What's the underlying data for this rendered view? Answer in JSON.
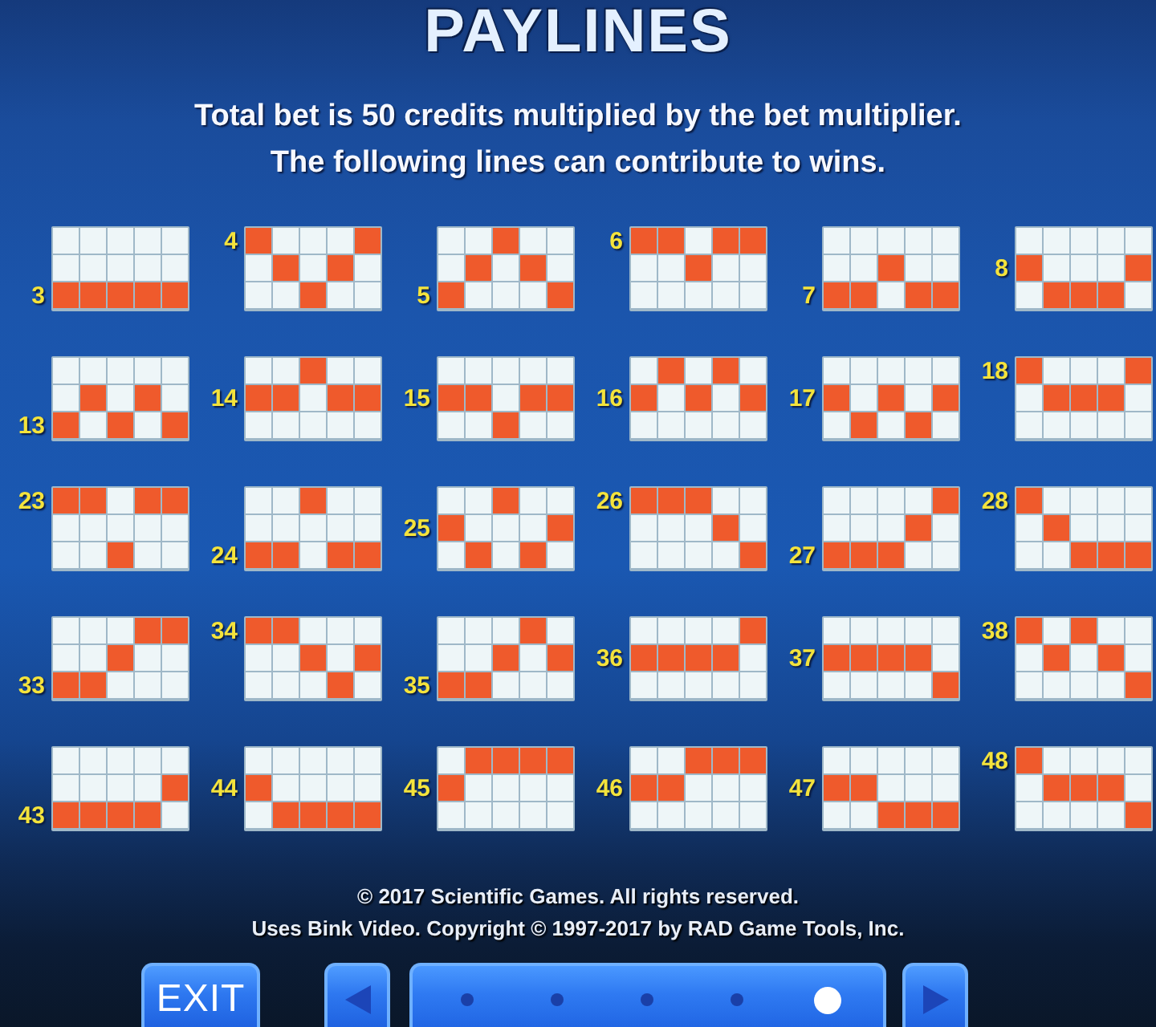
{
  "header": {
    "title": "PAYLINES",
    "lines": [
      "Total bet is 50 credits multiplied by the bet multiplier.",
      "The following lines can contribute to wins."
    ]
  },
  "paylines": [
    {
      "number": "3",
      "grid": [
        [
          false,
          false,
          false,
          false,
          false
        ],
        [
          false,
          false,
          false,
          false,
          false
        ],
        [
          true,
          true,
          true,
          true,
          true
        ]
      ]
    },
    {
      "number": "4",
      "grid": [
        [
          true,
          false,
          false,
          false,
          true
        ],
        [
          false,
          true,
          false,
          true,
          false
        ],
        [
          false,
          false,
          true,
          false,
          false
        ]
      ]
    },
    {
      "number": "5",
      "grid": [
        [
          false,
          false,
          true,
          false,
          false
        ],
        [
          false,
          true,
          false,
          true,
          false
        ],
        [
          true,
          false,
          false,
          false,
          true
        ]
      ]
    },
    {
      "number": "6",
      "grid": [
        [
          true,
          true,
          false,
          true,
          true
        ],
        [
          false,
          false,
          true,
          false,
          false
        ],
        [
          false,
          false,
          false,
          false,
          false
        ]
      ]
    },
    {
      "number": "7",
      "grid": [
        [
          false,
          false,
          false,
          false,
          false
        ],
        [
          false,
          false,
          true,
          false,
          false
        ],
        [
          true,
          true,
          false,
          true,
          true
        ]
      ]
    },
    {
      "number": "8",
      "grid": [
        [
          false,
          false,
          false,
          false,
          false
        ],
        [
          true,
          false,
          false,
          false,
          true
        ],
        [
          false,
          true,
          true,
          true,
          false
        ]
      ]
    },
    {
      "number": "13",
      "grid": [
        [
          false,
          false,
          false,
          false,
          false
        ],
        [
          false,
          true,
          false,
          true,
          false
        ],
        [
          true,
          false,
          true,
          false,
          true
        ]
      ]
    },
    {
      "number": "14",
      "grid": [
        [
          false,
          false,
          true,
          false,
          false
        ],
        [
          true,
          true,
          false,
          true,
          true
        ],
        [
          false,
          false,
          false,
          false,
          false
        ]
      ]
    },
    {
      "number": "15",
      "grid": [
        [
          false,
          false,
          false,
          false,
          false
        ],
        [
          true,
          true,
          false,
          true,
          true
        ],
        [
          false,
          false,
          true,
          false,
          false
        ]
      ]
    },
    {
      "number": "16",
      "grid": [
        [
          false,
          true,
          false,
          true,
          false
        ],
        [
          true,
          false,
          true,
          false,
          true
        ],
        [
          false,
          false,
          false,
          false,
          false
        ]
      ]
    },
    {
      "number": "17",
      "grid": [
        [
          false,
          false,
          false,
          false,
          false
        ],
        [
          true,
          false,
          true,
          false,
          true
        ],
        [
          false,
          true,
          false,
          true,
          false
        ]
      ]
    },
    {
      "number": "18",
      "grid": [
        [
          true,
          false,
          false,
          false,
          true
        ],
        [
          false,
          true,
          true,
          true,
          false
        ],
        [
          false,
          false,
          false,
          false,
          false
        ]
      ]
    },
    {
      "number": "23",
      "grid": [
        [
          true,
          true,
          false,
          true,
          true
        ],
        [
          false,
          false,
          false,
          false,
          false
        ],
        [
          false,
          false,
          true,
          false,
          false
        ]
      ]
    },
    {
      "number": "24",
      "grid": [
        [
          false,
          false,
          true,
          false,
          false
        ],
        [
          false,
          false,
          false,
          false,
          false
        ],
        [
          true,
          true,
          false,
          true,
          true
        ]
      ]
    },
    {
      "number": "25",
      "grid": [
        [
          false,
          false,
          true,
          false,
          false
        ],
        [
          true,
          false,
          false,
          false,
          true
        ],
        [
          false,
          true,
          false,
          true,
          false
        ]
      ]
    },
    {
      "number": "26",
      "grid": [
        [
          true,
          true,
          true,
          false,
          false
        ],
        [
          false,
          false,
          false,
          true,
          false
        ],
        [
          false,
          false,
          false,
          false,
          true
        ]
      ]
    },
    {
      "number": "27",
      "grid": [
        [
          false,
          false,
          false,
          false,
          true
        ],
        [
          false,
          false,
          false,
          true,
          false
        ],
        [
          true,
          true,
          true,
          false,
          false
        ]
      ]
    },
    {
      "number": "28",
      "grid": [
        [
          true,
          false,
          false,
          false,
          false
        ],
        [
          false,
          true,
          false,
          false,
          false
        ],
        [
          false,
          false,
          true,
          true,
          true
        ]
      ]
    },
    {
      "number": "33",
      "grid": [
        [
          false,
          false,
          false,
          true,
          true
        ],
        [
          false,
          false,
          true,
          false,
          false
        ],
        [
          true,
          true,
          false,
          false,
          false
        ]
      ]
    },
    {
      "number": "34",
      "grid": [
        [
          true,
          true,
          false,
          false,
          false
        ],
        [
          false,
          false,
          true,
          false,
          true
        ],
        [
          false,
          false,
          false,
          true,
          false
        ]
      ]
    },
    {
      "number": "35",
      "grid": [
        [
          false,
          false,
          false,
          true,
          false
        ],
        [
          false,
          false,
          true,
          false,
          true
        ],
        [
          true,
          true,
          false,
          false,
          false
        ]
      ]
    },
    {
      "number": "36",
      "grid": [
        [
          false,
          false,
          false,
          false,
          true
        ],
        [
          true,
          true,
          true,
          true,
          false
        ],
        [
          false,
          false,
          false,
          false,
          false
        ]
      ]
    },
    {
      "number": "37",
      "grid": [
        [
          false,
          false,
          false,
          false,
          false
        ],
        [
          true,
          true,
          true,
          true,
          false
        ],
        [
          false,
          false,
          false,
          false,
          true
        ]
      ]
    },
    {
      "number": "38",
      "grid": [
        [
          true,
          false,
          true,
          false,
          false
        ],
        [
          false,
          true,
          false,
          true,
          false
        ],
        [
          false,
          false,
          false,
          false,
          true
        ]
      ]
    },
    {
      "number": "43",
      "grid": [
        [
          false,
          false,
          false,
          false,
          false
        ],
        [
          false,
          false,
          false,
          false,
          true
        ],
        [
          true,
          true,
          true,
          true,
          false
        ]
      ]
    },
    {
      "number": "44",
      "grid": [
        [
          false,
          false,
          false,
          false,
          false
        ],
        [
          true,
          false,
          false,
          false,
          false
        ],
        [
          false,
          true,
          true,
          true,
          true
        ]
      ]
    },
    {
      "number": "45",
      "grid": [
        [
          false,
          true,
          true,
          true,
          true
        ],
        [
          true,
          false,
          false,
          false,
          false
        ],
        [
          false,
          false,
          false,
          false,
          false
        ]
      ]
    },
    {
      "number": "46",
      "grid": [
        [
          false,
          false,
          true,
          true,
          true
        ],
        [
          true,
          true,
          false,
          false,
          false
        ],
        [
          false,
          false,
          false,
          false,
          false
        ]
      ]
    },
    {
      "number": "47",
      "grid": [
        [
          false,
          false,
          false,
          false,
          false
        ],
        [
          true,
          true,
          false,
          false,
          false
        ],
        [
          false,
          false,
          true,
          true,
          true
        ]
      ]
    },
    {
      "number": "48",
      "grid": [
        [
          true,
          false,
          false,
          false,
          false
        ],
        [
          false,
          true,
          true,
          true,
          false
        ],
        [
          false,
          false,
          false,
          false,
          true
        ]
      ]
    }
  ],
  "footer": {
    "lines": [
      "© 2017 Scientific Games. All rights reserved.",
      "Uses Bink Video. Copyright © 1997-2017 by RAD Game Tools, Inc."
    ]
  },
  "nav": {
    "exit_button": "EXIT",
    "pages": [
      {
        "selected": false
      },
      {
        "selected": false
      },
      {
        "selected": false
      },
      {
        "selected": false
      },
      {
        "selected": true
      }
    ]
  }
}
